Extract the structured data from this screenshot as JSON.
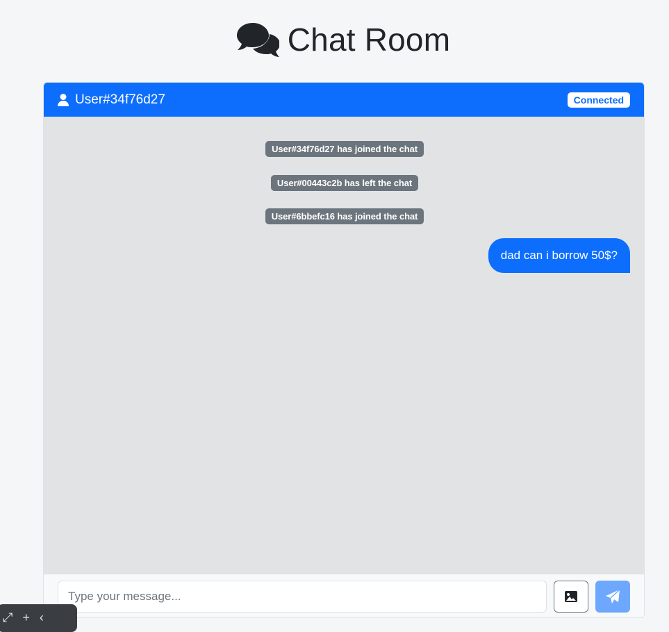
{
  "page": {
    "title": "Chat Room",
    "title_icon": "comments-icon"
  },
  "header": {
    "username": "User#34f76d27",
    "user_icon": "user-icon",
    "status": "Connected",
    "bg_color": "#0d6efd"
  },
  "messages": {
    "system": [
      "User#34f76d27 has joined the chat",
      "User#00443c2b has left the chat",
      "User#6bbefc16 has joined the chat"
    ],
    "sent": [
      "dad can i borrow 50$?"
    ]
  },
  "footer": {
    "input_placeholder": "Type your message...",
    "input_value": "",
    "image_button_icon": "image-icon",
    "send_button_icon": "paper-plane-icon",
    "send_button_color": "#6ea8fe"
  },
  "overlay_toolbar": {
    "icons": [
      "expand-icon",
      "plus-icon",
      "chevron-left-icon"
    ]
  }
}
